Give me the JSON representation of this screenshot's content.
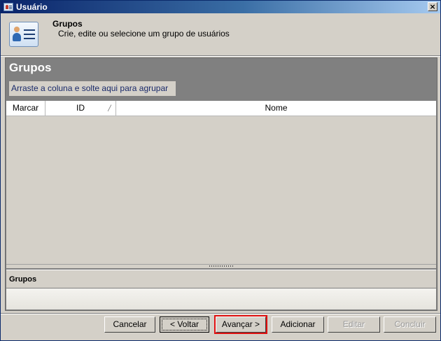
{
  "window": {
    "title": "Usuário",
    "close_label": "×"
  },
  "header": {
    "title": "Grupos",
    "subtitle": "Crie, edite ou selecione um grupo de usuários",
    "icon": "user-list-icon"
  },
  "panel": {
    "title": "Grupos",
    "group_by_hint": "Arraste a coluna e solte aqui para agrupar",
    "columns": [
      {
        "label": "Marcar"
      },
      {
        "label": "ID"
      },
      {
        "label": "Nome"
      }
    ],
    "rows": [],
    "detail_title": "Grupos"
  },
  "footer": {
    "cancel": "Cancelar",
    "back": "< Voltar",
    "next": "Avançar >",
    "add": "Adicionar",
    "edit": "Editar",
    "finish": "Concluir"
  },
  "colors": {
    "title_bar_start": "#0a246a",
    "title_bar_end": "#a6caf0",
    "panel_background": "#808080",
    "highlight_border": "#e01010"
  }
}
